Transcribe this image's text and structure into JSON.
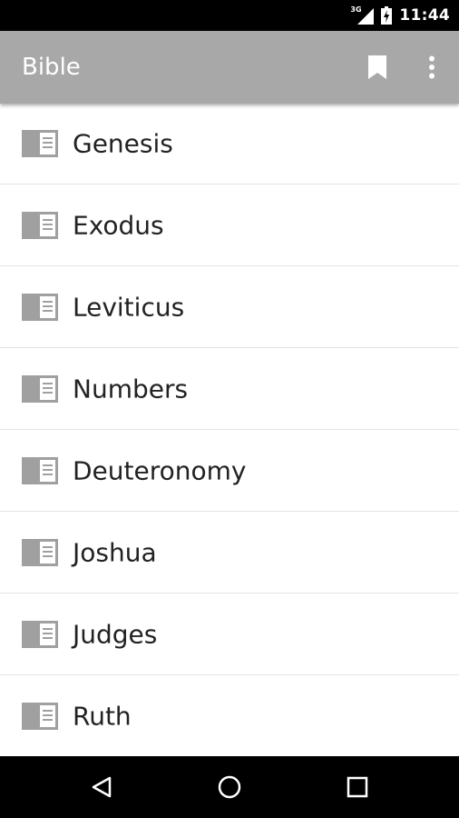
{
  "status_bar": {
    "network_label": "3G",
    "time": "11:44",
    "icons": [
      "signal-icon",
      "battery-charging-icon"
    ]
  },
  "app_bar": {
    "title": "Bible",
    "icons": [
      "bookmark-icon",
      "more-vert-icon"
    ]
  },
  "book_list": {
    "item_icon": "book-icon",
    "items": [
      {
        "label": "Genesis"
      },
      {
        "label": "Exodus"
      },
      {
        "label": "Leviticus"
      },
      {
        "label": "Numbers"
      },
      {
        "label": "Deuteronomy"
      },
      {
        "label": "Joshua"
      },
      {
        "label": "Judges"
      },
      {
        "label": "Ruth"
      }
    ]
  },
  "nav_bar": {
    "icons": [
      "back-icon",
      "home-icon",
      "recents-icon"
    ]
  },
  "colors": {
    "status_bar": "#000000",
    "app_bar": "#a8a8a8",
    "list_background": "#ffffff",
    "divider": "#e4e4e4",
    "text": "#222222",
    "icon": "#a0a0a0",
    "nav_bar": "#000000"
  }
}
